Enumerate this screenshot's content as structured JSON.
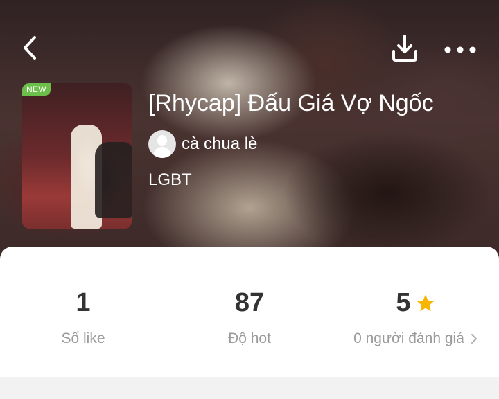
{
  "header": {
    "icons": {
      "back": "back-chevron-icon",
      "download": "download-icon",
      "more": "more-dots-icon"
    }
  },
  "book": {
    "badge": "NEW",
    "title": "[Rhycap] Đấu Giá Vợ Ngốc",
    "author": "cà chua lè",
    "genre": "LGBT"
  },
  "stats": {
    "likes": {
      "value": "1",
      "label": "Số like"
    },
    "hot": {
      "value": "87",
      "label": "Độ hot"
    },
    "rating": {
      "value": "5",
      "label": "0 người đánh giá",
      "icon": "star-icon",
      "icon_color": "#f7b500"
    }
  },
  "colors": {
    "badge": "#6cc04a",
    "star": "#f7b500"
  }
}
